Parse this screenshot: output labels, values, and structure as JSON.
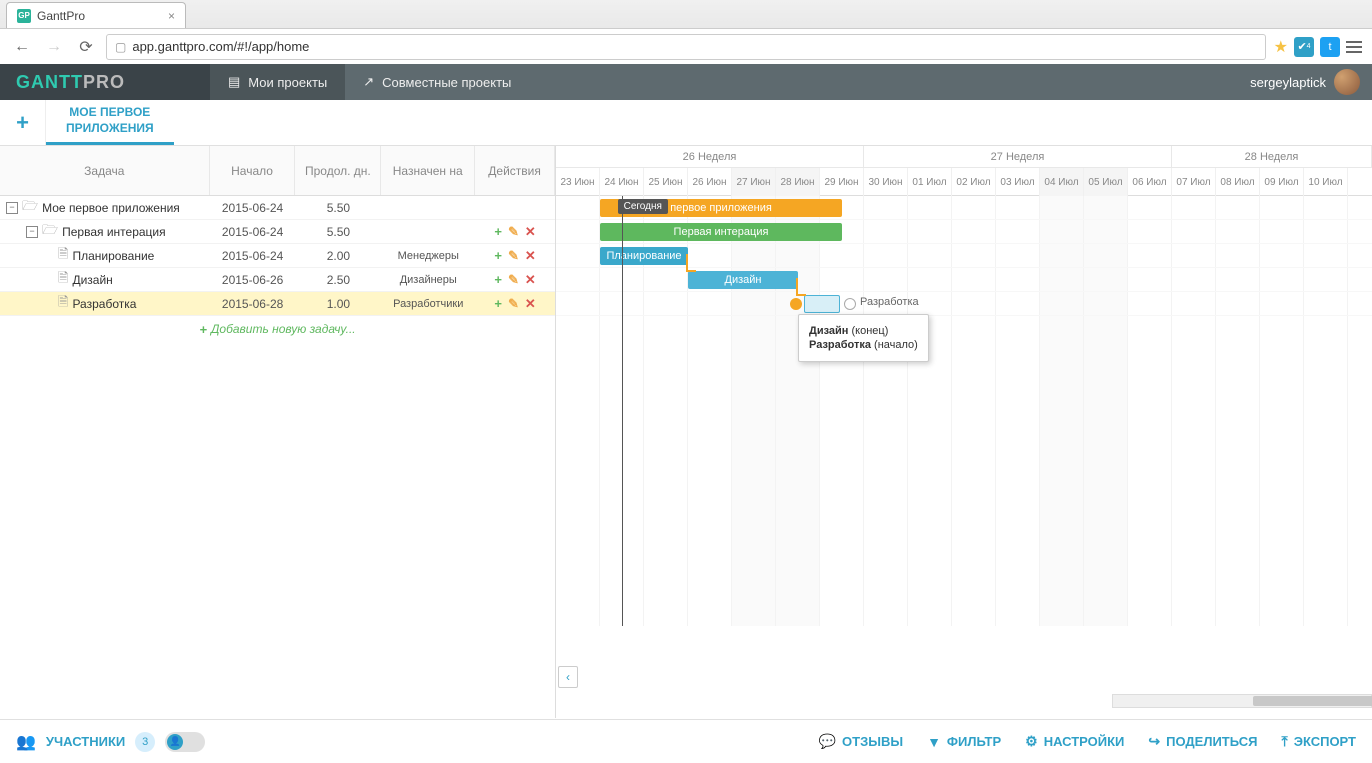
{
  "browser": {
    "tab_title": "GanttPro",
    "url": "app.ganttpro.com/#!/app/home"
  },
  "header": {
    "logo_a": "GANTT",
    "logo_b": "PRO",
    "my_projects": "Мои проекты",
    "shared_projects": "Совместные проекты",
    "username": "sergeylaptick"
  },
  "project_tab": "МОЕ ПЕРВОЕ\nПРИЛОЖЕНИЯ",
  "columns": {
    "task": "Задача",
    "start": "Начало",
    "duration": "Продол. дн.",
    "assigned": "Назначен на",
    "actions": "Действия"
  },
  "tasks": [
    {
      "name": "Мое первое приложения",
      "start": "2015-06-24",
      "dur": "5.50",
      "assigned": "",
      "level": 0,
      "type": "folder",
      "expandable": true
    },
    {
      "name": "Первая интерация",
      "start": "2015-06-24",
      "dur": "5.50",
      "assigned": "",
      "level": 1,
      "type": "folder",
      "expandable": true
    },
    {
      "name": "Планирование",
      "start": "2015-06-24",
      "dur": "2.00",
      "assigned": "Менеджеры",
      "level": 2,
      "type": "file"
    },
    {
      "name": "Дизайн",
      "start": "2015-06-26",
      "dur": "2.50",
      "assigned": "Дизайнеры",
      "level": 2,
      "type": "file"
    },
    {
      "name": "Разработка",
      "start": "2015-06-28",
      "dur": "1.00",
      "assigned": "Разработчики",
      "level": 2,
      "type": "file",
      "highlight": true
    }
  ],
  "add_task": "Добавить новую задачу...",
  "timeline": {
    "weeks": [
      "26 Неделя",
      "27 Неделя",
      "28 Неделя"
    ],
    "days": [
      {
        "label": "23 Июн"
      },
      {
        "label": "24 Июн"
      },
      {
        "label": "25 Июн"
      },
      {
        "label": "26 Июн"
      },
      {
        "label": "27 Июн",
        "weekend": true
      },
      {
        "label": "28 Июн",
        "weekend": true
      },
      {
        "label": "29 Июн"
      },
      {
        "label": "30 Июн"
      },
      {
        "label": "01 Июл"
      },
      {
        "label": "02 Июл"
      },
      {
        "label": "03 Июл"
      },
      {
        "label": "04 Июл",
        "weekend": true
      },
      {
        "label": "05 Июл",
        "weekend": true
      },
      {
        "label": "06 Июл"
      },
      {
        "label": "07 Июл"
      },
      {
        "label": "08 Июл"
      },
      {
        "label": "09 Июл"
      },
      {
        "label": "10 Июл"
      }
    ],
    "today_label": "Сегодня",
    "bar_labels": {
      "project": "первое приложения",
      "iteration": "Первая интерация",
      "plan": "Планирование",
      "design": "Дизайн",
      "dev": "Разработка"
    }
  },
  "tooltip": {
    "line1_a": "Дизайн",
    "line1_b": "(конец)",
    "line2_a": "Разработка",
    "line2_b": "(начало)"
  },
  "footer": {
    "members": "УЧАСТНИКИ",
    "members_count": "3",
    "reviews": "ОТЗЫВЫ",
    "filter": "ФИЛЬТР",
    "settings": "НАСТРОЙКИ",
    "share": "ПОДЕЛИТЬСЯ",
    "export": "ЭКСПОРТ"
  }
}
